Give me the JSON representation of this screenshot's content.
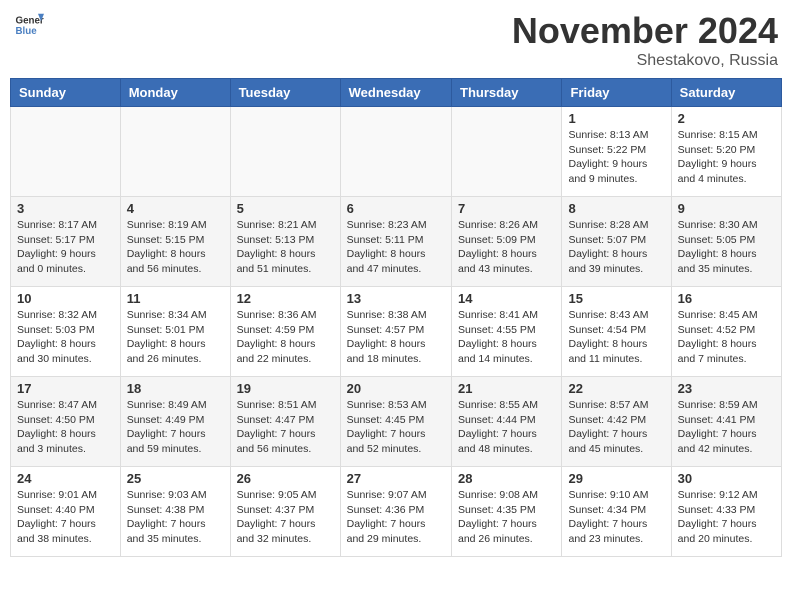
{
  "header": {
    "logo_general": "General",
    "logo_blue": "Blue",
    "month_title": "November 2024",
    "location": "Shestakovo, Russia"
  },
  "weekdays": [
    "Sunday",
    "Monday",
    "Tuesday",
    "Wednesday",
    "Thursday",
    "Friday",
    "Saturday"
  ],
  "weeks": [
    [
      {
        "day": "",
        "info": ""
      },
      {
        "day": "",
        "info": ""
      },
      {
        "day": "",
        "info": ""
      },
      {
        "day": "",
        "info": ""
      },
      {
        "day": "",
        "info": ""
      },
      {
        "day": "1",
        "info": "Sunrise: 8:13 AM\nSunset: 5:22 PM\nDaylight: 9 hours and 9 minutes."
      },
      {
        "day": "2",
        "info": "Sunrise: 8:15 AM\nSunset: 5:20 PM\nDaylight: 9 hours and 4 minutes."
      }
    ],
    [
      {
        "day": "3",
        "info": "Sunrise: 8:17 AM\nSunset: 5:17 PM\nDaylight: 9 hours and 0 minutes."
      },
      {
        "day": "4",
        "info": "Sunrise: 8:19 AM\nSunset: 5:15 PM\nDaylight: 8 hours and 56 minutes."
      },
      {
        "day": "5",
        "info": "Sunrise: 8:21 AM\nSunset: 5:13 PM\nDaylight: 8 hours and 51 minutes."
      },
      {
        "day": "6",
        "info": "Sunrise: 8:23 AM\nSunset: 5:11 PM\nDaylight: 8 hours and 47 minutes."
      },
      {
        "day": "7",
        "info": "Sunrise: 8:26 AM\nSunset: 5:09 PM\nDaylight: 8 hours and 43 minutes."
      },
      {
        "day": "8",
        "info": "Sunrise: 8:28 AM\nSunset: 5:07 PM\nDaylight: 8 hours and 39 minutes."
      },
      {
        "day": "9",
        "info": "Sunrise: 8:30 AM\nSunset: 5:05 PM\nDaylight: 8 hours and 35 minutes."
      }
    ],
    [
      {
        "day": "10",
        "info": "Sunrise: 8:32 AM\nSunset: 5:03 PM\nDaylight: 8 hours and 30 minutes."
      },
      {
        "day": "11",
        "info": "Sunrise: 8:34 AM\nSunset: 5:01 PM\nDaylight: 8 hours and 26 minutes."
      },
      {
        "day": "12",
        "info": "Sunrise: 8:36 AM\nSunset: 4:59 PM\nDaylight: 8 hours and 22 minutes."
      },
      {
        "day": "13",
        "info": "Sunrise: 8:38 AM\nSunset: 4:57 PM\nDaylight: 8 hours and 18 minutes."
      },
      {
        "day": "14",
        "info": "Sunrise: 8:41 AM\nSunset: 4:55 PM\nDaylight: 8 hours and 14 minutes."
      },
      {
        "day": "15",
        "info": "Sunrise: 8:43 AM\nSunset: 4:54 PM\nDaylight: 8 hours and 11 minutes."
      },
      {
        "day": "16",
        "info": "Sunrise: 8:45 AM\nSunset: 4:52 PM\nDaylight: 8 hours and 7 minutes."
      }
    ],
    [
      {
        "day": "17",
        "info": "Sunrise: 8:47 AM\nSunset: 4:50 PM\nDaylight: 8 hours and 3 minutes."
      },
      {
        "day": "18",
        "info": "Sunrise: 8:49 AM\nSunset: 4:49 PM\nDaylight: 7 hours and 59 minutes."
      },
      {
        "day": "19",
        "info": "Sunrise: 8:51 AM\nSunset: 4:47 PM\nDaylight: 7 hours and 56 minutes."
      },
      {
        "day": "20",
        "info": "Sunrise: 8:53 AM\nSunset: 4:45 PM\nDaylight: 7 hours and 52 minutes."
      },
      {
        "day": "21",
        "info": "Sunrise: 8:55 AM\nSunset: 4:44 PM\nDaylight: 7 hours and 48 minutes."
      },
      {
        "day": "22",
        "info": "Sunrise: 8:57 AM\nSunset: 4:42 PM\nDaylight: 7 hours and 45 minutes."
      },
      {
        "day": "23",
        "info": "Sunrise: 8:59 AM\nSunset: 4:41 PM\nDaylight: 7 hours and 42 minutes."
      }
    ],
    [
      {
        "day": "24",
        "info": "Sunrise: 9:01 AM\nSunset: 4:40 PM\nDaylight: 7 hours and 38 minutes."
      },
      {
        "day": "25",
        "info": "Sunrise: 9:03 AM\nSunset: 4:38 PM\nDaylight: 7 hours and 35 minutes."
      },
      {
        "day": "26",
        "info": "Sunrise: 9:05 AM\nSunset: 4:37 PM\nDaylight: 7 hours and 32 minutes."
      },
      {
        "day": "27",
        "info": "Sunrise: 9:07 AM\nSunset: 4:36 PM\nDaylight: 7 hours and 29 minutes."
      },
      {
        "day": "28",
        "info": "Sunrise: 9:08 AM\nSunset: 4:35 PM\nDaylight: 7 hours and 26 minutes."
      },
      {
        "day": "29",
        "info": "Sunrise: 9:10 AM\nSunset: 4:34 PM\nDaylight: 7 hours and 23 minutes."
      },
      {
        "day": "30",
        "info": "Sunrise: 9:12 AM\nSunset: 4:33 PM\nDaylight: 7 hours and 20 minutes."
      }
    ]
  ]
}
